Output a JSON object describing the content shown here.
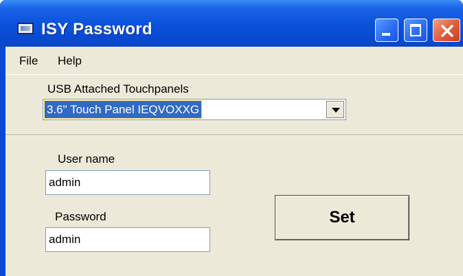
{
  "window": {
    "title": "ISY Password",
    "icon": "app-window-icon",
    "controls": [
      "minimize-icon",
      "maximize-icon",
      "close-icon"
    ],
    "colors": {
      "titlebar": "#0b53dc",
      "close": "#e1603f",
      "client": "#ece9d8"
    }
  },
  "menu": {
    "file_label": "File",
    "help_label": "Help"
  },
  "touchpanels": {
    "label": "USB Attached Touchpanels",
    "selected": "3.6\" Touch Panel IEQVOXXG"
  },
  "username": {
    "label": "User name",
    "value": "admin"
  },
  "password": {
    "label": "Password",
    "value": "admin"
  },
  "set_button": {
    "label": "Set"
  }
}
